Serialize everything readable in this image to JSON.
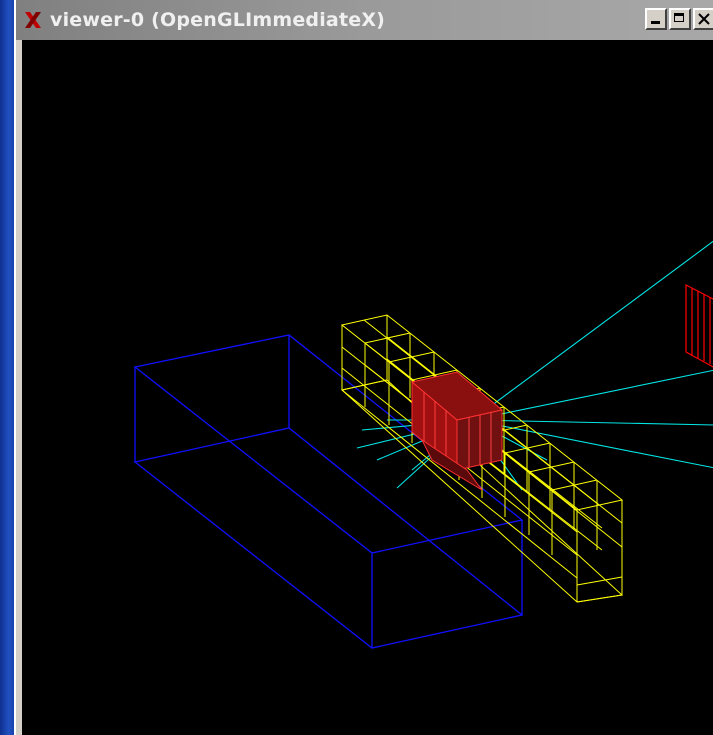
{
  "window": {
    "title": "viewer-0 (OpenGLImmediateX)",
    "buttons": [
      "minimize",
      "maximize",
      "close"
    ]
  },
  "colors": {
    "desktop": "#1a3a9a",
    "titlebar": "#9a9a9a",
    "viewport_background": "#000000",
    "volume_blue": "#1010ff",
    "detector_yellow": "#ffff00",
    "trajectory_cyan": "#00e5e5",
    "hits_red": "#ff0000"
  }
}
